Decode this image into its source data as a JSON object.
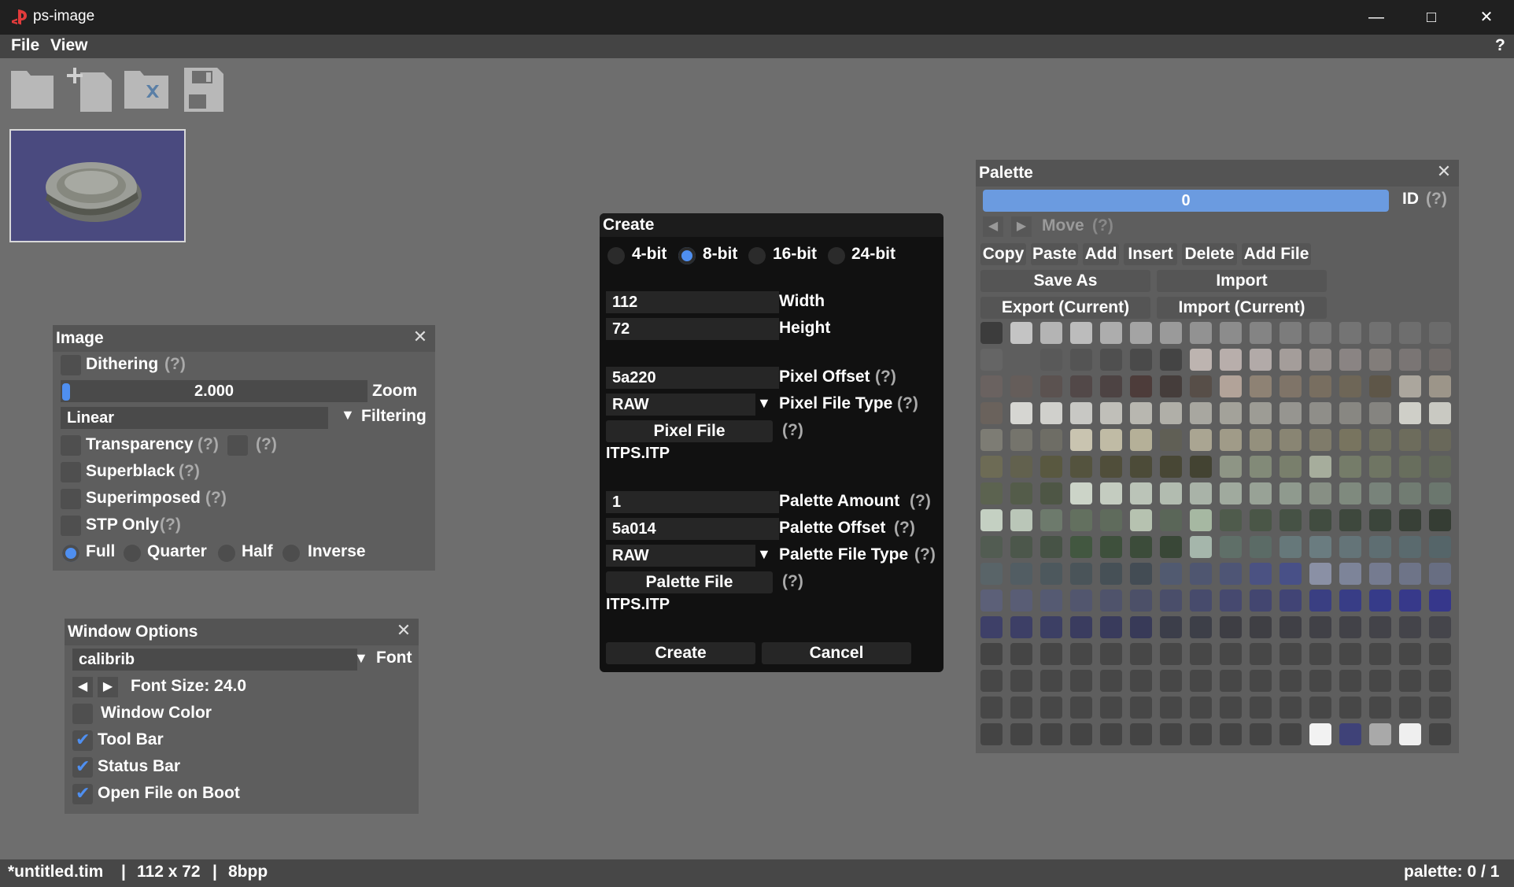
{
  "window": {
    "title": "ps-image",
    "help_label": "?"
  },
  "menu": {
    "file": "File",
    "view": "View"
  },
  "toolbar": {
    "open": "open-folder-icon",
    "new": "new-file-icon",
    "close": "close-folder-icon",
    "save": "save-icon"
  },
  "image_panel": {
    "title": "Image",
    "dithering": "Dithering",
    "help": "(?)",
    "zoom_value": "2.000",
    "zoom_fraction": 0.0,
    "zoom_label": "Zoom",
    "filtering_value": "Linear",
    "filtering_label": "Filtering",
    "transparency": "Transparency",
    "superblack": "Superblack",
    "superimposed": "Superimposed",
    "stp_only": "STP Only",
    "modes": [
      "Full",
      "Quarter",
      "Half",
      "Inverse"
    ],
    "selected_mode": "Full"
  },
  "window_options": {
    "title": "Window Options",
    "font_value": "calibrib",
    "font_label": "Font",
    "font_size": "Font Size: 24.0",
    "window_color": "Window Color",
    "tool_bar": "Tool Bar",
    "status_bar": "Status Bar",
    "open_on_boot": "Open File on Boot"
  },
  "create": {
    "title": "Create",
    "bit_options": [
      "4-bit",
      "8-bit",
      "16-bit",
      "24-bit"
    ],
    "selected_bit": "8-bit",
    "width_value": "112",
    "width_label": "Width",
    "height_value": "72",
    "height_label": "Height",
    "pixel_offset_value": "5a220",
    "pixel_offset_label": "Pixel Offset",
    "pixel_type_value": "RAW",
    "pixel_type_label": "Pixel File Type",
    "pixel_file_button": "Pixel File",
    "pixel_file_name": "ITPS.ITP",
    "palette_amount_value": "1",
    "palette_amount_label": "Palette Amount",
    "palette_offset_value": "5a014",
    "palette_offset_label": "Palette Offset",
    "palette_type_value": "RAW",
    "palette_type_label": "Palette File Type",
    "palette_file_button": "Palette File",
    "palette_file_name": "ITPS.ITP",
    "help": "(?)",
    "create_button": "Create",
    "cancel_button": "Cancel"
  },
  "palette": {
    "title": "Palette",
    "id_value": "0",
    "id_label": "ID",
    "help": "(?)",
    "move_label": "Move",
    "buttons": [
      "Copy",
      "Paste",
      "Add",
      "Insert",
      "Delete",
      "Add File"
    ],
    "save_as": "Save As",
    "import": "Import",
    "export_current": "Export (Current)",
    "import_current": "Import (Current)",
    "swatches": [
      [
        "#3c3c3c",
        "#c4c4c4",
        "#b4b4b4",
        "#bcbcbc",
        "#adadad",
        "#a4a4a4",
        "#9a9a9a",
        "#929292",
        "#8c8c8c",
        "#848484",
        "#7c7c7c",
        "#777777",
        "#747474",
        "#717171",
        "#6e6e6e",
        "#6b6b6b"
      ],
      [
        "#656565",
        "#5e5e5e",
        "#595959",
        "#545454",
        "#4f4f4f",
        "#4a4a4a",
        "#444444",
        "#bdb4b0",
        "#b8aeab",
        "#b2aaa8",
        "#a49d9a",
        "#958f8c",
        "#8a8483",
        "#827d7a",
        "#7a7574",
        "#706b69"
      ],
      [
        "#6a6260",
        "#655d5a",
        "#5b5250",
        "#524848",
        "#4d4343",
        "#4d3c3a",
        "#453d3b",
        "#574e48",
        "#b2a399",
        "#8e8274",
        "#7f7468",
        "#786e60",
        "#6e6657",
        "#5e5648",
        "#aba69d",
        "#9c9589"
      ],
      [
        "#6a625c",
        "#d6d6d2",
        "#d0d0cc",
        "#c8c8c4",
        "#c0bfb9",
        "#b8b7b0",
        "#b0afa8",
        "#a8a7a0",
        "#a3a29a",
        "#9d9c95",
        "#969590",
        "#8f8e89",
        "#888782",
        "#858480",
        "#cfcfc8",
        "#c9c9c2"
      ],
      [
        "#7d7c74",
        "#75746c",
        "#6e6d65",
        "#c9c4b0",
        "#c0bba5",
        "#b5b098",
        "#605f55",
        "#aaa592",
        "#a09b88",
        "#94907d",
        "#898573",
        "#7f7b6a",
        "#78745f",
        "#70705f",
        "#6d6c5c",
        "#69685a"
      ],
      [
        "#6d6b55",
        "#62614e",
        "#595840",
        "#54533e",
        "#504e3a",
        "#4c4b38",
        "#484735",
        "#434332",
        "#8e9585",
        "#828a78",
        "#797f6c",
        "#a6ad9c",
        "#757c69",
        "#6f7563",
        "#686e5d",
        "#62685a"
      ],
      [
        "#5c6350",
        "#545c4a",
        "#4e5645",
        "#ccd4c8",
        "#c4ccc0",
        "#bbc4b8",
        "#b2bcb0",
        "#a9b3a8",
        "#a0aa9e",
        "#98a296",
        "#8f9a8e",
        "#878f84",
        "#7f8a7e",
        "#78837a",
        "#717c72",
        "#6b776e"
      ],
      [
        "#c4d0c2",
        "#bac6b8",
        "#6d7a6c",
        "#63705f",
        "#5f6b5c",
        "#b6c2b0",
        "#5a6658",
        "#a6b8a2",
        "#4f5b4c",
        "#4a5647",
        "#465245",
        "#414c40",
        "#3e483d",
        "#3b453b",
        "#384037",
        "#353d34"
      ],
      [
        "#525c52",
        "#4c574b",
        "#475346",
        "#425740",
        "#3e503c",
        "#3c4c3a",
        "#394737",
        "#a5b6ab",
        "#5f6f68",
        "#5b6b66",
        "#66787a",
        "#6a7c80",
        "#647478",
        "#5e6e72",
        "#5a6a6e",
        "#556569"
      ],
      [
        "#596468",
        "#525d63",
        "#4d585d",
        "#4a5459",
        "#465056",
        "#434c54",
        "#515a70",
        "#4f5670",
        "#4e5575",
        "#4b5282",
        "#485087",
        "#8a90a5",
        "#7d8499",
        "#757b90",
        "#6e7488",
        "#686e82"
      ],
      [
        "#5c6078",
        "#595d75",
        "#555a72",
        "#52566e",
        "#4f536b",
        "#4c5068",
        "#4a4e6a",
        "#474b6c",
        "#46496f",
        "#434670",
        "#414475",
        "#3a3f82",
        "#383d86",
        "#363b89",
        "#37398a",
        "#36378b"
      ],
      [
        "#3e4068",
        "#3d3f66",
        "#3c3f64",
        "#3a3c5f",
        "#393b5c",
        "#383a58",
        "#3c3e4a",
        "#3d3f48",
        "#3e3e44",
        "#3f3f44",
        "#404046",
        "#414147",
        "#424248",
        "#434349",
        "#44444a",
        "#45454b"
      ],
      [
        "#444444",
        "#454545",
        "#464646",
        "#474747",
        "#474747",
        "#474747",
        "#474747",
        "#474747",
        "#474747",
        "#474747",
        "#474747",
        "#474747",
        "#474747",
        "#474747",
        "#474747",
        "#474747"
      ],
      [
        "#474747",
        "#474747",
        "#474747",
        "#474747",
        "#474747",
        "#474747",
        "#474747",
        "#474747",
        "#474747",
        "#474747",
        "#474747",
        "#474747",
        "#474747",
        "#474747",
        "#474747",
        "#474747"
      ],
      [
        "#474747",
        "#474747",
        "#474747",
        "#474747",
        "#474747",
        "#474747",
        "#474747",
        "#474747",
        "#474747",
        "#474747",
        "#474747",
        "#474747",
        "#474747",
        "#474747",
        "#474747",
        "#474747"
      ],
      [
        "#444444",
        "#444444",
        "#444444",
        "#444444",
        "#444444",
        "#444444",
        "#444444",
        "#444444",
        "#444444",
        "#444444",
        "#444444",
        "#f2f2f2",
        "#3f4278",
        "#a9a9a9",
        "#efefef",
        "#444444"
      ]
    ]
  },
  "status": {
    "file": "*untitled.tim",
    "sep": "|",
    "size": "112 x 72",
    "bpp": "8bpp",
    "palette": "palette: 0 / 1"
  },
  "colors": {
    "accent": "#4f8ff0",
    "background": "#6e6e6e",
    "titlebar": "#202020"
  }
}
